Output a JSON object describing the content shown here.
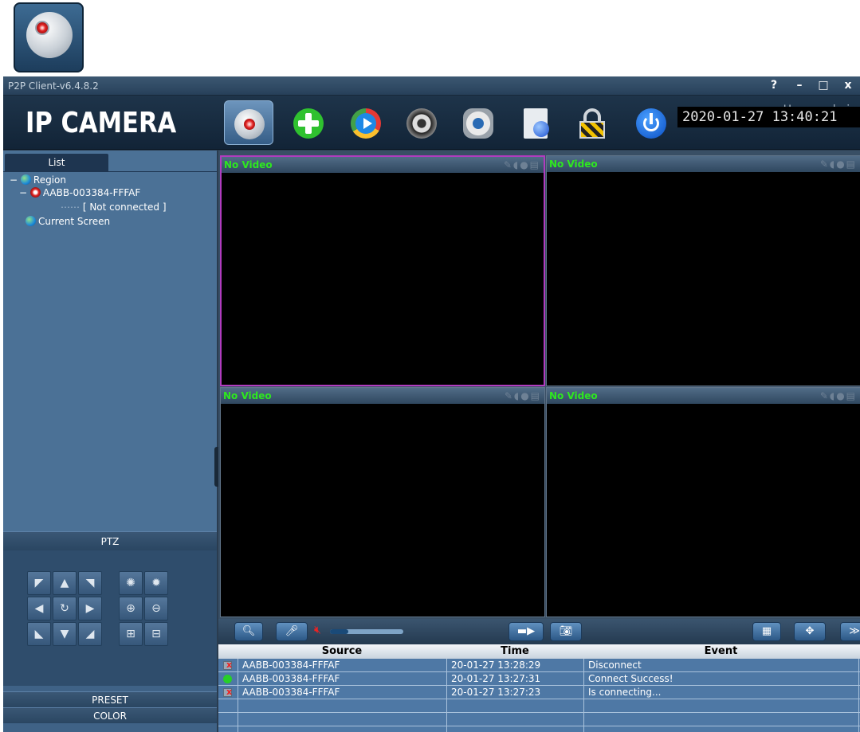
{
  "window": {
    "title": "P2P Client-v6.4.8.2",
    "help_label": "?",
    "minimize_label": "–",
    "maximize_label": "□",
    "close_label": "x"
  },
  "header": {
    "brand": "IP CAMERA",
    "users_text": "Users: admin",
    "datetime": "2020-01-27 13:40:21"
  },
  "toolbar": {
    "buttons": [
      "camera-monitor-icon",
      "add-device-icon",
      "playback-icon",
      "ptz-control-icon",
      "settings-icon",
      "log-report-icon",
      "lock-icon",
      "power-icon"
    ]
  },
  "sidebar": {
    "tab_label": "List",
    "tree": {
      "region_label": "Region",
      "device_label": "AABB-003384-FFFAF",
      "device_status": "[  Not connected  ]",
      "current_screen_label": "Current Screen"
    },
    "ptz_label": "PTZ",
    "preset_label": "PRESET",
    "color_label": "COLOR"
  },
  "video": {
    "panes": [
      "No Video",
      "No Video",
      "No Video",
      "No Video"
    ]
  },
  "log": {
    "columns": [
      "Source",
      "Time",
      "Event"
    ],
    "rows": [
      {
        "status": "error",
        "source": "AABB-003384-FFFAF",
        "time": "20-01-27 13:28:29",
        "event": "Disconnect"
      },
      {
        "status": "ok",
        "source": "AABB-003384-FFFAF",
        "time": "20-01-27 13:27:31",
        "event": "Connect Success!"
      },
      {
        "status": "error",
        "source": "AABB-003384-FFFAF",
        "time": "20-01-27 13:27:23",
        "event": "Is connecting..."
      }
    ]
  },
  "controls": {
    "volume_level": 0.25
  },
  "colors": {
    "accent": "#2ee81f",
    "selected_border": "#b13cbf",
    "panel": "#4b7196"
  }
}
